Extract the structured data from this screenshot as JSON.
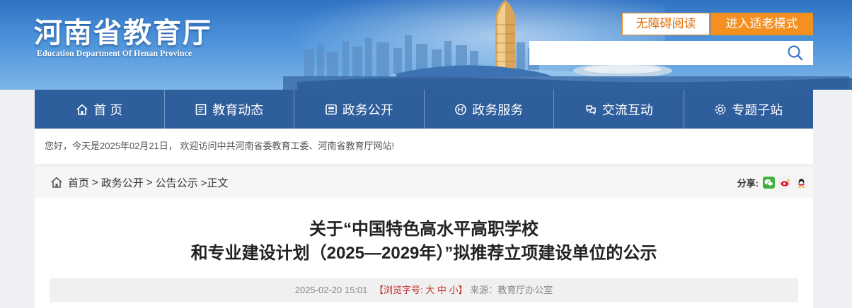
{
  "header": {
    "site_name": "河南省教育厅",
    "site_name_en": "Education Department Of Henan Province",
    "accessibility_button": "无障碍阅读",
    "elder_mode_button": "进入适老模式",
    "search_placeholder": "",
    "colors": {
      "accent_orange": "#f4901f",
      "nav_blue": "#2f5e9d"
    }
  },
  "nav": {
    "items": [
      {
        "label": "首 页",
        "icon": "home-icon"
      },
      {
        "label": "教育动态",
        "icon": "news-icon"
      },
      {
        "label": "政务公开",
        "icon": "notice-board-icon"
      },
      {
        "label": "政务服务",
        "icon": "gov-service-icon"
      },
      {
        "label": "交流互动",
        "icon": "interaction-icon"
      },
      {
        "label": "专题子站",
        "icon": "gear-icon"
      }
    ]
  },
  "welcome": {
    "text": "您好，今天是2025年02月21日， 欢迎访问中共河南省委教育工委、河南省教育厅网站!"
  },
  "breadcrumb": {
    "items": [
      "首页",
      "政务公开",
      "公告公示"
    ],
    "separator": ">",
    "current": ">正文"
  },
  "share": {
    "label": "分享:",
    "targets": [
      "wechat-icon",
      "weibo-icon",
      "qq-icon"
    ]
  },
  "article": {
    "title_line1": "关于“中国特色高水平高职学校",
    "title_line2": "和专业建设计划（2025—2029年）”拟推荐立项建设单位的公示",
    "date": "2025-02-20 15:01",
    "font_size_label": "【浏览字号:",
    "font_sizes": [
      "大",
      "中",
      "小"
    ],
    "font_size_close": "】",
    "source": "来源：教育厅办公室"
  }
}
